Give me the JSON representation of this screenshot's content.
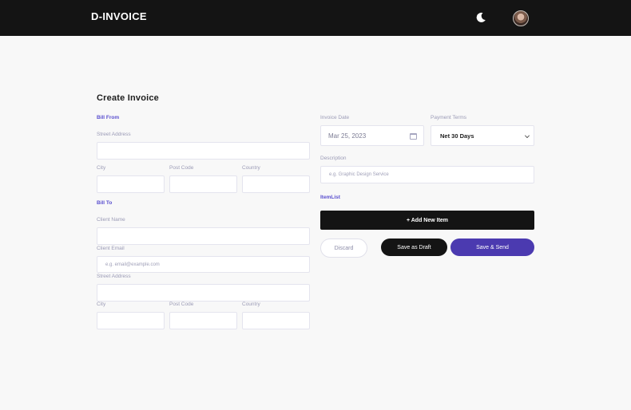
{
  "header": {
    "brand": "D-INVOICE",
    "theme_icon": "moon-icon",
    "avatar_icon": "user-avatar"
  },
  "form": {
    "title": "Create Invoice",
    "bill_from": {
      "heading": "Bill From",
      "street_label": "Street Address",
      "city_label": "City",
      "post_code_label": "Post Code",
      "country_label": "Country"
    },
    "bill_to": {
      "heading": "Bill To",
      "client_name_label": "Client Name",
      "client_email_label": "Client Email",
      "client_email_placeholder": "e.g. email@example.com",
      "street_label": "Street Address",
      "city_label": "City",
      "post_code_label": "Post Code",
      "country_label": "Country"
    },
    "invoice_date_label": "Invoice Date",
    "invoice_date_value": "Mar 25, 2023",
    "payment_terms_label": "Payment Terms",
    "payment_terms_value": "Net 30 Days",
    "description_label": "Description",
    "description_placeholder": "e.g. Graphic Design Service",
    "item_list_heading": "ItemList",
    "add_item_label": "+ Add New Item",
    "discard_label": "Discard",
    "save_draft_label": "Save as Draft",
    "save_send_label": "Save & Send"
  },
  "colors": {
    "header_bg": "#141414",
    "accent": "#4b3ab0",
    "section_heading": "#5a4fcf"
  }
}
